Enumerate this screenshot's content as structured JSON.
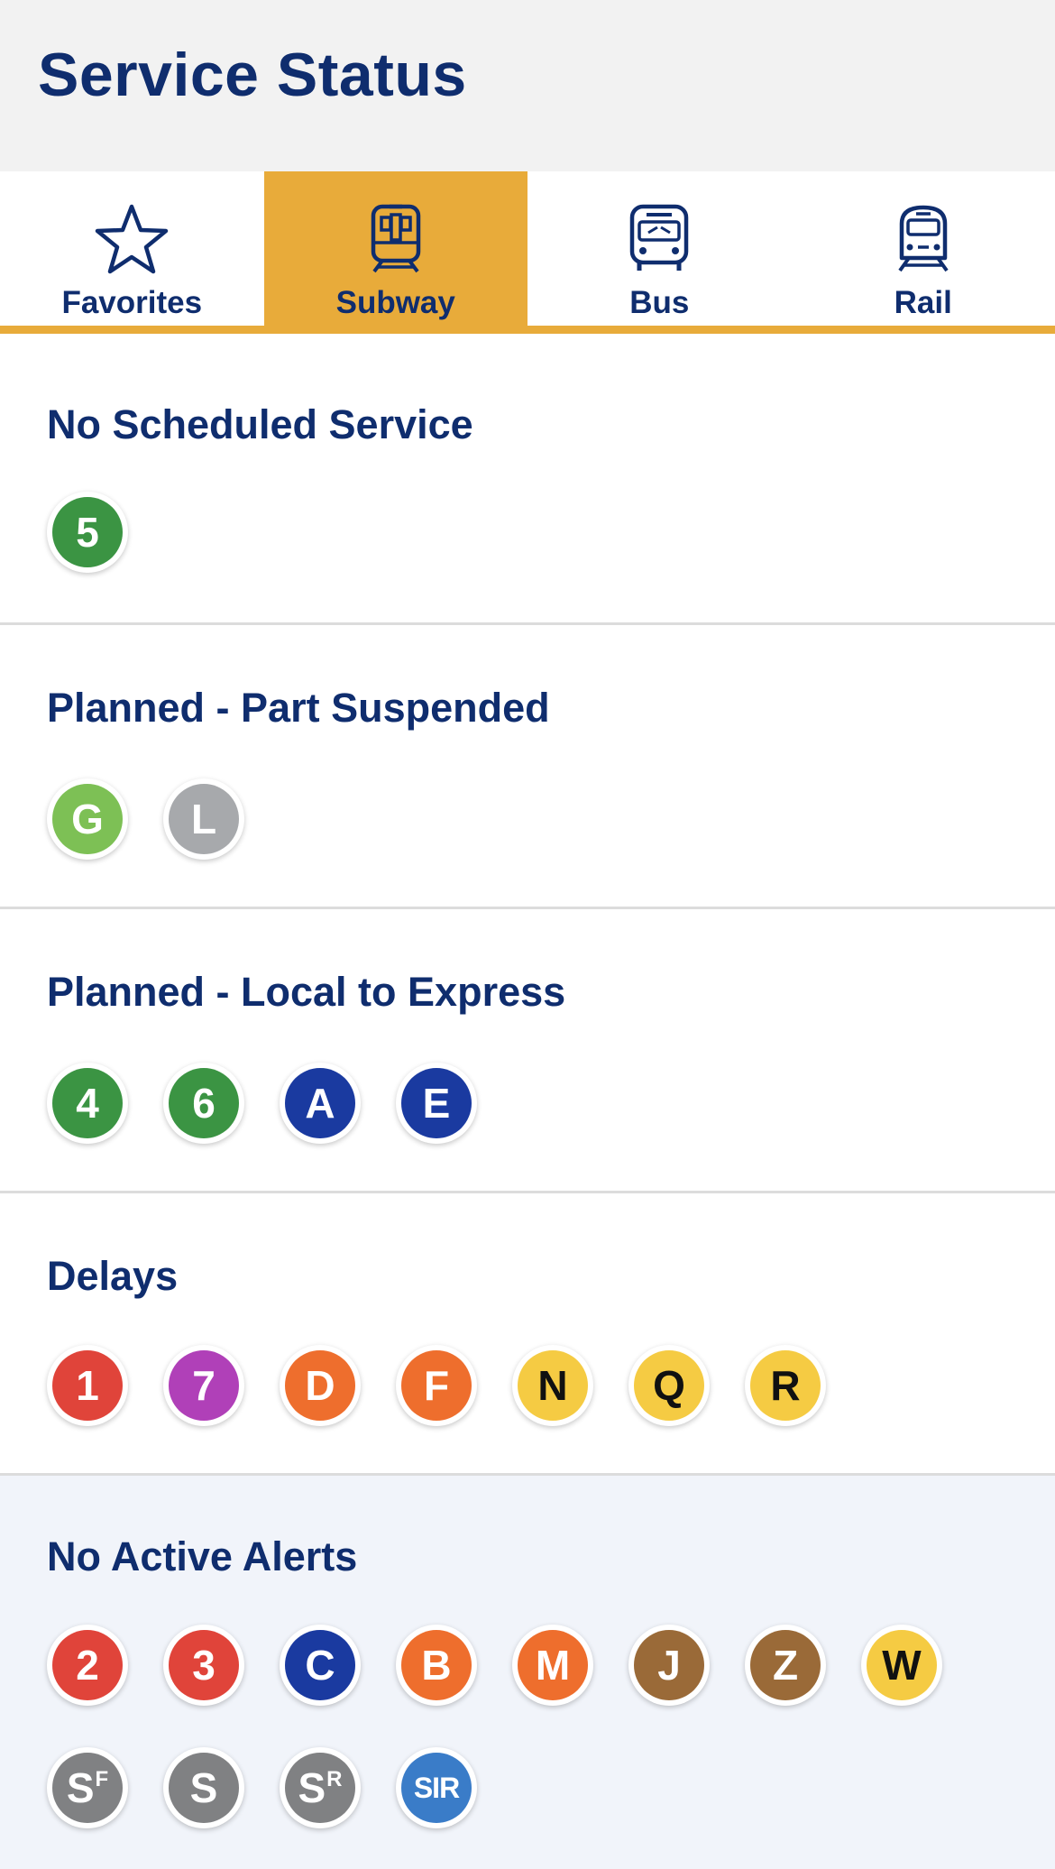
{
  "header": {
    "title": "Service Status"
  },
  "tabs": [
    {
      "label": "Favorites",
      "icon": "star-icon",
      "active": false
    },
    {
      "label": "Subway",
      "icon": "subway-icon",
      "active": true
    },
    {
      "label": "Bus",
      "icon": "bus-icon",
      "active": false
    },
    {
      "label": "Rail",
      "icon": "rail-icon",
      "active": false
    }
  ],
  "colors": {
    "accent": "#e8ab3a",
    "title": "#0f2d6e",
    "header_bg": "#f2f2f2",
    "alt_section_bg": "#f1f4fa"
  },
  "sections": [
    {
      "title": "No Scheduled Service",
      "lines": [
        {
          "label": "5",
          "color": "#3b9443"
        }
      ]
    },
    {
      "title": "Planned - Part Suspended",
      "lines": [
        {
          "label": "G",
          "color": "#7dc055"
        },
        {
          "label": "L",
          "color": "#a7a9ac"
        }
      ]
    },
    {
      "title": "Planned - Local to Express",
      "lines": [
        {
          "label": "4",
          "color": "#3b9443"
        },
        {
          "label": "6",
          "color": "#3b9443"
        },
        {
          "label": "A",
          "color": "#1a3aa0"
        },
        {
          "label": "E",
          "color": "#1a3aa0"
        }
      ]
    },
    {
      "title": "Delays",
      "lines": [
        {
          "label": "1",
          "color": "#e0443a"
        },
        {
          "label": "7",
          "color": "#b040b8"
        },
        {
          "label": "D",
          "color": "#ee6e2d"
        },
        {
          "label": "F",
          "color": "#ee6e2d"
        },
        {
          "label": "N",
          "color": "#f5cb43",
          "dark": true
        },
        {
          "label": "Q",
          "color": "#f5cb43",
          "dark": true
        },
        {
          "label": "R",
          "color": "#f5cb43",
          "dark": true
        }
      ]
    },
    {
      "title": "No Active Alerts",
      "lines": [
        {
          "label": "2",
          "color": "#e0443a"
        },
        {
          "label": "3",
          "color": "#e0443a"
        },
        {
          "label": "C",
          "color": "#1a3aa0"
        },
        {
          "label": "B",
          "color": "#ee6e2d"
        },
        {
          "label": "M",
          "color": "#ee6e2d"
        },
        {
          "label": "J",
          "color": "#9a6a38"
        },
        {
          "label": "Z",
          "color": "#9a6a38"
        },
        {
          "label": "W",
          "color": "#f5cb43",
          "dark": true
        },
        {
          "label": "S",
          "sup": "F",
          "color": "#808183"
        },
        {
          "label": "S",
          "color": "#808183"
        },
        {
          "label": "S",
          "sup": "R",
          "color": "#808183"
        },
        {
          "label": "SIR",
          "color": "#3a7cc8",
          "small": true
        }
      ]
    }
  ]
}
